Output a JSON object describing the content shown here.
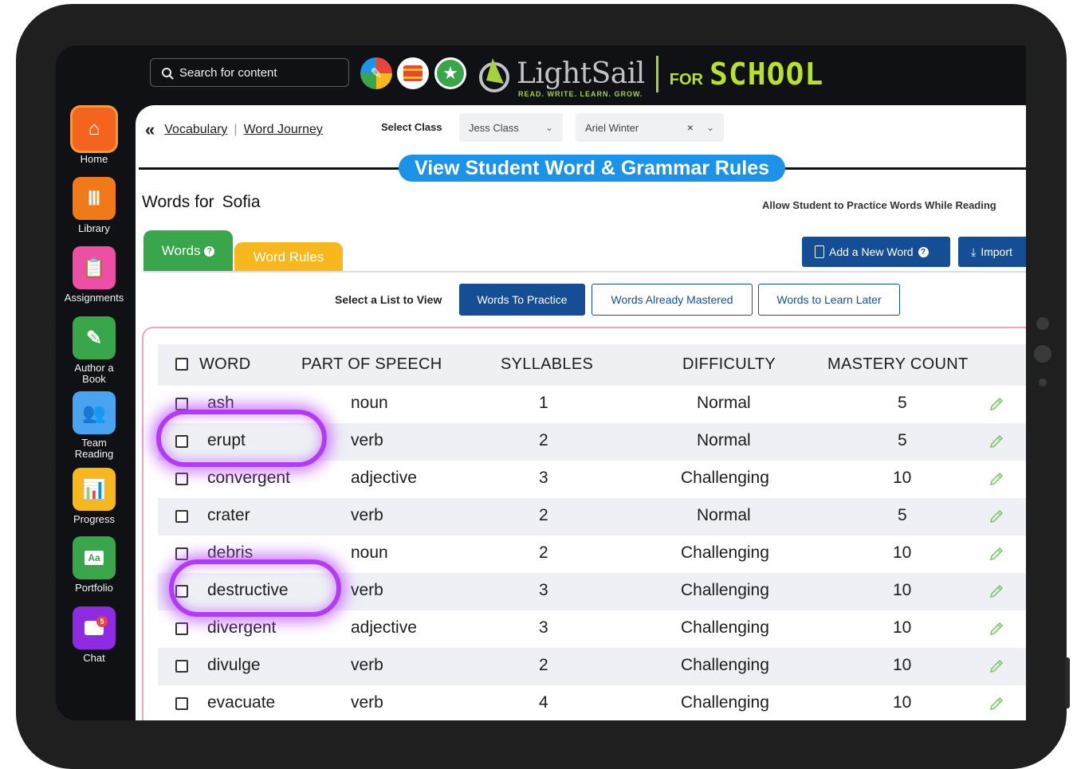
{
  "search": {
    "placeholder": "Search for content"
  },
  "brand": {
    "name": "LightSail",
    "tagline": "READ. WRITE. LEARN. GROW.",
    "for": "FOR",
    "school": "SCHOOL"
  },
  "sidebar": {
    "items": [
      {
        "label": "Home",
        "color": "#f4641f"
      },
      {
        "label": "Library",
        "color": "#f07a1a"
      },
      {
        "label": "Assignments",
        "color": "#ec4fa3"
      },
      {
        "label": "Author a Book",
        "color": "#3aa64c"
      },
      {
        "label": "Team Reading",
        "color": "#4aa3f0"
      },
      {
        "label": "Progress",
        "color": "#f6b81c"
      },
      {
        "label": "Portfolio",
        "color": "#3aa64c"
      },
      {
        "label": "Chat",
        "color": "#8e2be2"
      }
    ],
    "chat_badge": "5"
  },
  "breadcrumb": {
    "item1": "Vocabulary",
    "item2": "Word Journey"
  },
  "filters": {
    "select_class_label": "Select Class",
    "class_value": "Jess Class",
    "student_value": "Ariel Winter"
  },
  "page_title": "View Student Word & Grammar Rules",
  "words_for": {
    "label": "Words for",
    "student": "Sofia"
  },
  "allow_text": "Allow Student to Practice Words While Reading",
  "tabs": {
    "words": "Words",
    "word_rules": "Word Rules"
  },
  "actions": {
    "add_word": "Add a New Word",
    "import": "Import"
  },
  "list_select": {
    "label": "Select a List to View",
    "options": [
      "Words To Practice",
      "Words Already Mastered",
      "Words to Learn Later"
    ],
    "active": "Words To Practice"
  },
  "table": {
    "headers": [
      "WORD",
      "PART OF SPEECH",
      "SYLLABLES",
      "DIFFICULTY",
      "MASTERY COUNT"
    ],
    "rows": [
      {
        "word": "ash",
        "pos": "noun",
        "syllables": "1",
        "difficulty": "Normal",
        "mastery": "5"
      },
      {
        "word": "erupt",
        "pos": "verb",
        "syllables": "2",
        "difficulty": "Normal",
        "mastery": "5"
      },
      {
        "word": "convergent",
        "pos": "adjective",
        "syllables": "3",
        "difficulty": "Challenging",
        "mastery": "10"
      },
      {
        "word": "crater",
        "pos": "verb",
        "syllables": "2",
        "difficulty": "Normal",
        "mastery": "5"
      },
      {
        "word": "debris",
        "pos": "noun",
        "syllables": "2",
        "difficulty": "Challenging",
        "mastery": "10"
      },
      {
        "word": "destructive",
        "pos": "verb",
        "syllables": "3",
        "difficulty": "Challenging",
        "mastery": "10"
      },
      {
        "word": "divergent",
        "pos": "adjective",
        "syllables": "3",
        "difficulty": "Challenging",
        "mastery": "10"
      },
      {
        "word": "divulge",
        "pos": "verb",
        "syllables": "2",
        "difficulty": "Challenging",
        "mastery": "10"
      },
      {
        "word": "evacuate",
        "pos": "verb",
        "syllables": "4",
        "difficulty": "Challenging",
        "mastery": "10"
      }
    ]
  },
  "colors": {
    "accent_blue": "#164e95",
    "title_blue": "#1a93e8",
    "highlight": "#b23cf6",
    "edit_green": "#7cc96a"
  }
}
